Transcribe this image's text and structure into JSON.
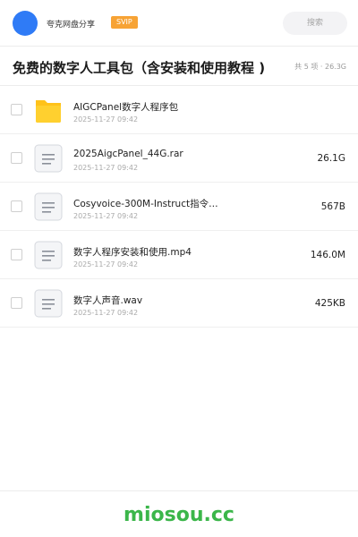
{
  "header": {
    "share_name": "夸克网盘分享",
    "badge": "SVIP",
    "search_placeholder": "搜索"
  },
  "share": {
    "title": "免费的数字人工具包（含安装和使用教程 )",
    "summary": "共 5 项 · 26.3G"
  },
  "files": [
    {
      "name": "AIGCPanel数字人程序包",
      "date": "2025-11-27 09:42",
      "size": "",
      "icon": "folder-icon"
    },
    {
      "name": "2025AigcPanel_44G.rar",
      "date": "2025-11-27 09:42",
      "size": "26.1G",
      "icon": "file-icon"
    },
    {
      "name": "Cosyvoice-300M-Instruct指令…",
      "date": "2025-11-27 09:42",
      "size": "567B",
      "icon": "file-icon"
    },
    {
      "name": "数字人程序安装和使用.mp4",
      "date": "2025-11-27 09:42",
      "size": "146.0M",
      "icon": "file-icon"
    },
    {
      "name": "数字人声音.wav",
      "date": "2025-11-27 09:42",
      "size": "425KB",
      "icon": "file-icon"
    }
  ],
  "footer": {
    "brand": "miosou.cc"
  },
  "colors": {
    "accent": "#2f7bf6",
    "svip": "#f7a335",
    "folder": "#ffc21a",
    "brand": "#3bb64a"
  }
}
